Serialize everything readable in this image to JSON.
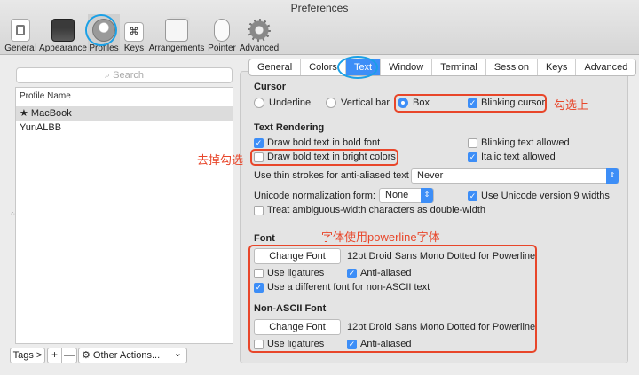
{
  "window": {
    "title": "Preferences"
  },
  "toolbar": [
    {
      "label": "General",
      "icon": "general-icon"
    },
    {
      "label": "Appearance",
      "icon": "appearance-icon"
    },
    {
      "label": "Profiles",
      "icon": "profiles-icon"
    },
    {
      "label": "Keys",
      "icon": "keys-icon"
    },
    {
      "label": "Arrangements",
      "icon": "arrangements-icon"
    },
    {
      "label": "Pointer",
      "icon": "pointer-icon"
    },
    {
      "label": "Advanced",
      "icon": "advanced-icon"
    }
  ],
  "profiles": {
    "search_placeholder": "Search",
    "column_header": "Profile Name",
    "items": [
      {
        "name": "★ MacBook"
      },
      {
        "name": "YunALBB"
      }
    ],
    "tags_label": "Tags >",
    "add_label": "+",
    "remove_label": "—",
    "other_actions_label": "Other Actions...",
    "other_actions_chevron": "⌄",
    "resize_glyph": "⁘"
  },
  "tabs": [
    "General",
    "Colors",
    "Text",
    "Window",
    "Terminal",
    "Session",
    "Keys",
    "Advanced"
  ],
  "cursor": {
    "title": "Cursor",
    "options": [
      {
        "label": "Underline",
        "checked": false
      },
      {
        "label": "Vertical bar",
        "checked": false
      },
      {
        "label": "Box",
        "checked": true
      }
    ],
    "blinking_label": "Blinking cursor",
    "blinking_checked": true
  },
  "text_rendering": {
    "title": "Text Rendering",
    "draw_bold_font": "Draw bold text in bold font",
    "blinking_text": "Blinking text allowed",
    "draw_bold_bright": "Draw bold text in bright colors",
    "italic_text": "Italic text allowed",
    "thin_strokes_label": "Use thin strokes for anti-aliased text",
    "thin_strokes_value": "Never",
    "unicode_label": "Unicode normalization form:",
    "unicode_value": "None",
    "unicode_v9": "Use Unicode version 9 widths",
    "ambiguous_width": "Treat ambiguous-width characters as double-width"
  },
  "font": {
    "title": "Font",
    "change_font_label": "Change Font",
    "font_desc": "12pt Droid Sans Mono Dotted for Powerline",
    "ligatures": "Use ligatures",
    "anti_aliased": "Anti-aliased",
    "different_font": "Use a different font for non-ASCII text"
  },
  "non_ascii_font": {
    "title": "Non-ASCII Font",
    "change_font_label": "Change Font",
    "font_desc": "12pt Droid Sans Mono Dotted for Powerline",
    "ligatures": "Use ligatures",
    "anti_aliased": "Anti-aliased"
  },
  "annotations": {
    "check_on": "勾选上",
    "uncheck": "去掉勾选",
    "use_powerline": "字体使用powerline字体"
  },
  "colors": {
    "accent": "#3d8ef7",
    "annotation_red": "#e8462a",
    "annotation_blue": "#1aa0e6"
  }
}
